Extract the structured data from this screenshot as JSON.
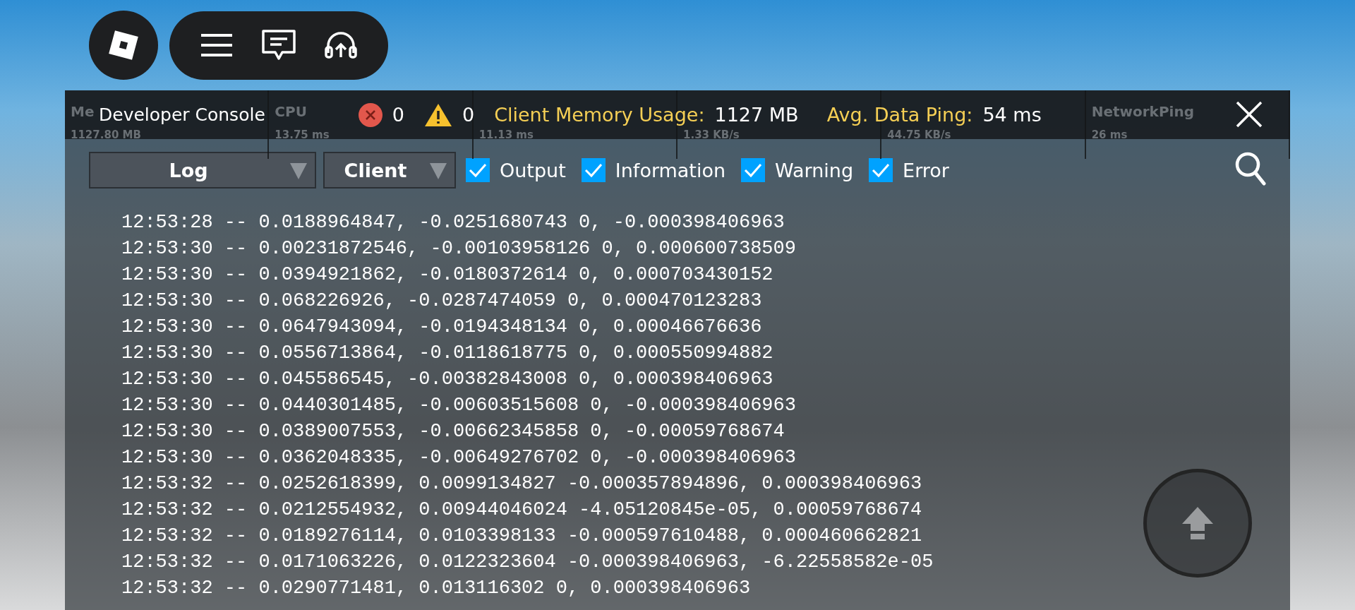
{
  "stats": [
    {
      "label": "Me",
      "value": "1127.80 MB"
    },
    {
      "label": "CPU",
      "value": "13.75 ms"
    },
    {
      "value": "11.13 ms"
    },
    {
      "value": "1.33 KB/s"
    },
    {
      "value": "44.75 KB/s"
    },
    {
      "label": "NetworkPing",
      "value": "26 ms"
    }
  ],
  "console": {
    "title": "Developer Console",
    "error_count": "0",
    "warning_count": "0",
    "memory_label": "Client Memory Usage:",
    "memory_value": "1127 MB",
    "ping_label": "Avg. Data Ping:",
    "ping_value": "54 ms"
  },
  "filters": {
    "dropdowns": [
      {
        "label": "Log"
      },
      {
        "label": "Client"
      }
    ],
    "checkboxes": [
      {
        "label": "Output",
        "checked": true
      },
      {
        "label": "Information",
        "checked": true
      },
      {
        "label": "Warning",
        "checked": true
      },
      {
        "label": "Error",
        "checked": true
      }
    ]
  },
  "log_lines": [
    "12:53:28 -- 0.0188964847, -0.0251680743 0, -0.000398406963",
    "12:53:30 -- 0.00231872546, -0.00103958126 0, 0.000600738509",
    "12:53:30 -- 0.0394921862, -0.0180372614 0, 0.000703430152",
    "12:53:30 -- 0.068226926, -0.0287474059 0, 0.000470123283",
    "12:53:30 -- 0.0647943094, -0.0194348134 0, 0.00046676636",
    "12:53:30 -- 0.0556713864, -0.0118618775 0, 0.000550994882",
    "12:53:30 -- 0.045586545, -0.00382843008 0, 0.000398406963",
    "12:53:30 -- 0.0440301485, -0.00603515608 0, -0.000398406963",
    "12:53:30 -- 0.0389007553, -0.00662345858 0, -0.00059768674",
    "12:53:30 -- 0.0362048335, -0.00649276702 0, -0.000398406963",
    "12:53:32 -- 0.0252618399, 0.0099134827 -0.000357894896, 0.000398406963",
    "12:53:32 -- 0.0212554932, 0.00944046024 -4.05120845e-05, 0.00059768674",
    "12:53:32 -- 0.0189276114, 0.0103398133 -0.000597610488, 0.000460662821",
    "12:53:32 -- 0.0171063226, 0.0122323604 -0.000398406963, -6.22558582e-05",
    "12:53:32 -- 0.0290771481, 0.013116302 0, 0.000398406963"
  ]
}
